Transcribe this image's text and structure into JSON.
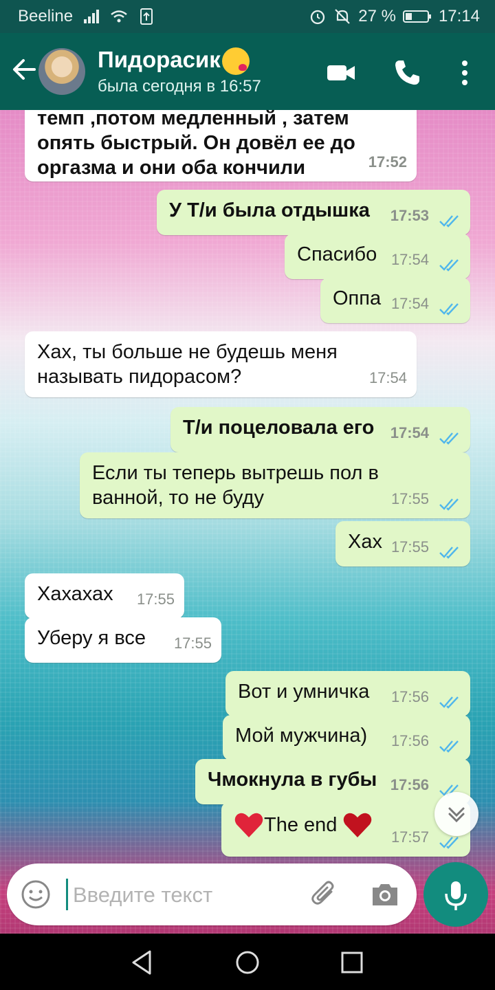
{
  "status_bar": {
    "carrier": "Beeline",
    "battery": "27 %",
    "time": "17:14"
  },
  "header": {
    "name": "Пидорасик",
    "emoji_icon": "face-blowing-kiss-emoji",
    "status": "была сегодня в 16:57"
  },
  "messages": [
    {
      "dir": "in",
      "text": "темп ,потом медленный , затем опять быстрый. Он довёл ее до оргазма и они оба кончили",
      "time": "17:52",
      "bold": true
    },
    {
      "dir": "out",
      "text": "У Т/и была отдышка",
      "time": "17:53",
      "bold": true
    },
    {
      "dir": "out",
      "text": "Спасибо",
      "time": "17:54"
    },
    {
      "dir": "out",
      "text": "Оппа",
      "time": "17:54"
    },
    {
      "dir": "in",
      "text": "Хах, ты больше не будешь меня называть пидорасом?",
      "time": "17:54"
    },
    {
      "dir": "out",
      "text": "Т/и поцеловала его",
      "time": "17:54",
      "bold": true
    },
    {
      "dir": "out",
      "text": "Если ты теперь вытрешь пол в ванной, то не буду",
      "time": "17:55"
    },
    {
      "dir": "out",
      "text": "Хах",
      "time": "17:55"
    },
    {
      "dir": "in",
      "text": "Хахахах",
      "time": "17:55"
    },
    {
      "dir": "in",
      "text": "Уберу я все",
      "time": "17:55"
    },
    {
      "dir": "out",
      "text": "Вот и умничка",
      "time": "17:56"
    },
    {
      "dir": "out",
      "text": "Мой мужчина)",
      "time": "17:56"
    },
    {
      "dir": "out",
      "text": "Чмокнула в губы",
      "time": "17:56",
      "bold": true
    },
    {
      "dir": "out",
      "text": "The end",
      "time": "17:57",
      "emoji": "red-heart-emoji"
    }
  ],
  "composer": {
    "placeholder": "Введите текст"
  },
  "colors": {
    "header": "#075e54",
    "outgoing_bubble": "#e1f7c8",
    "incoming_bubble": "#ffffff",
    "accent": "#128c7e",
    "read_ticks": "#4fb6ec"
  }
}
